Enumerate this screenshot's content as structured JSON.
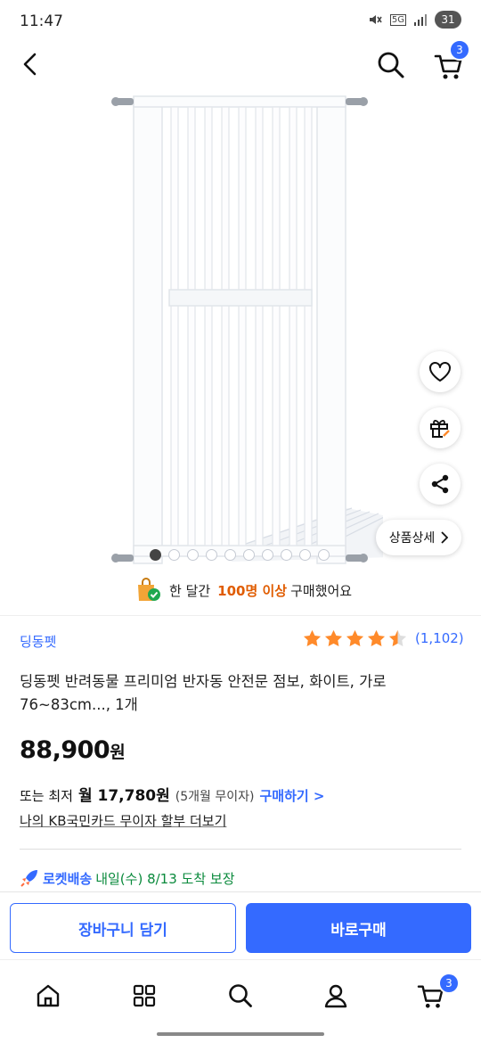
{
  "status_bar": {
    "time": "11:47",
    "network": "5G",
    "battery": "31"
  },
  "header": {
    "cart_count": "3"
  },
  "product_image": {
    "alt_icon": "safety-gate-image",
    "slide_count": 10,
    "active_slide": 1
  },
  "side_actions": {
    "detail_label": "상품상세"
  },
  "purchase_note": {
    "prefix": "한 달간",
    "highlight": "100명 이상",
    "suffix": "구매했어요"
  },
  "product": {
    "brand": "딩동펫",
    "rating": 4.5,
    "review_count": "(1,102)",
    "title": "딩동펫 반려동물 프리미엄 반자동 안전문 점보, 화이트, 가로 76~83cm..., 1개",
    "price": "88,900",
    "price_unit": "원"
  },
  "installment": {
    "prefix": "또는 최저",
    "amount": "월 17,780원",
    "months": "(5개월 무이자)",
    "link": "구매하기 >"
  },
  "card_link": "나의 KB국민카드 무이자 할부 더보기",
  "delivery": {
    "label": "로켓배송",
    "eta": "내일(수) 8/13 도착 보장"
  },
  "actions": {
    "cart": "장바구니 담기",
    "buy": "바로구매"
  },
  "nav": {
    "cart_count": "3"
  },
  "colors": {
    "accent": "#346aff",
    "highlight": "#e05c00",
    "star": "#ff8a2a",
    "delivery": "#0a8a3c"
  }
}
